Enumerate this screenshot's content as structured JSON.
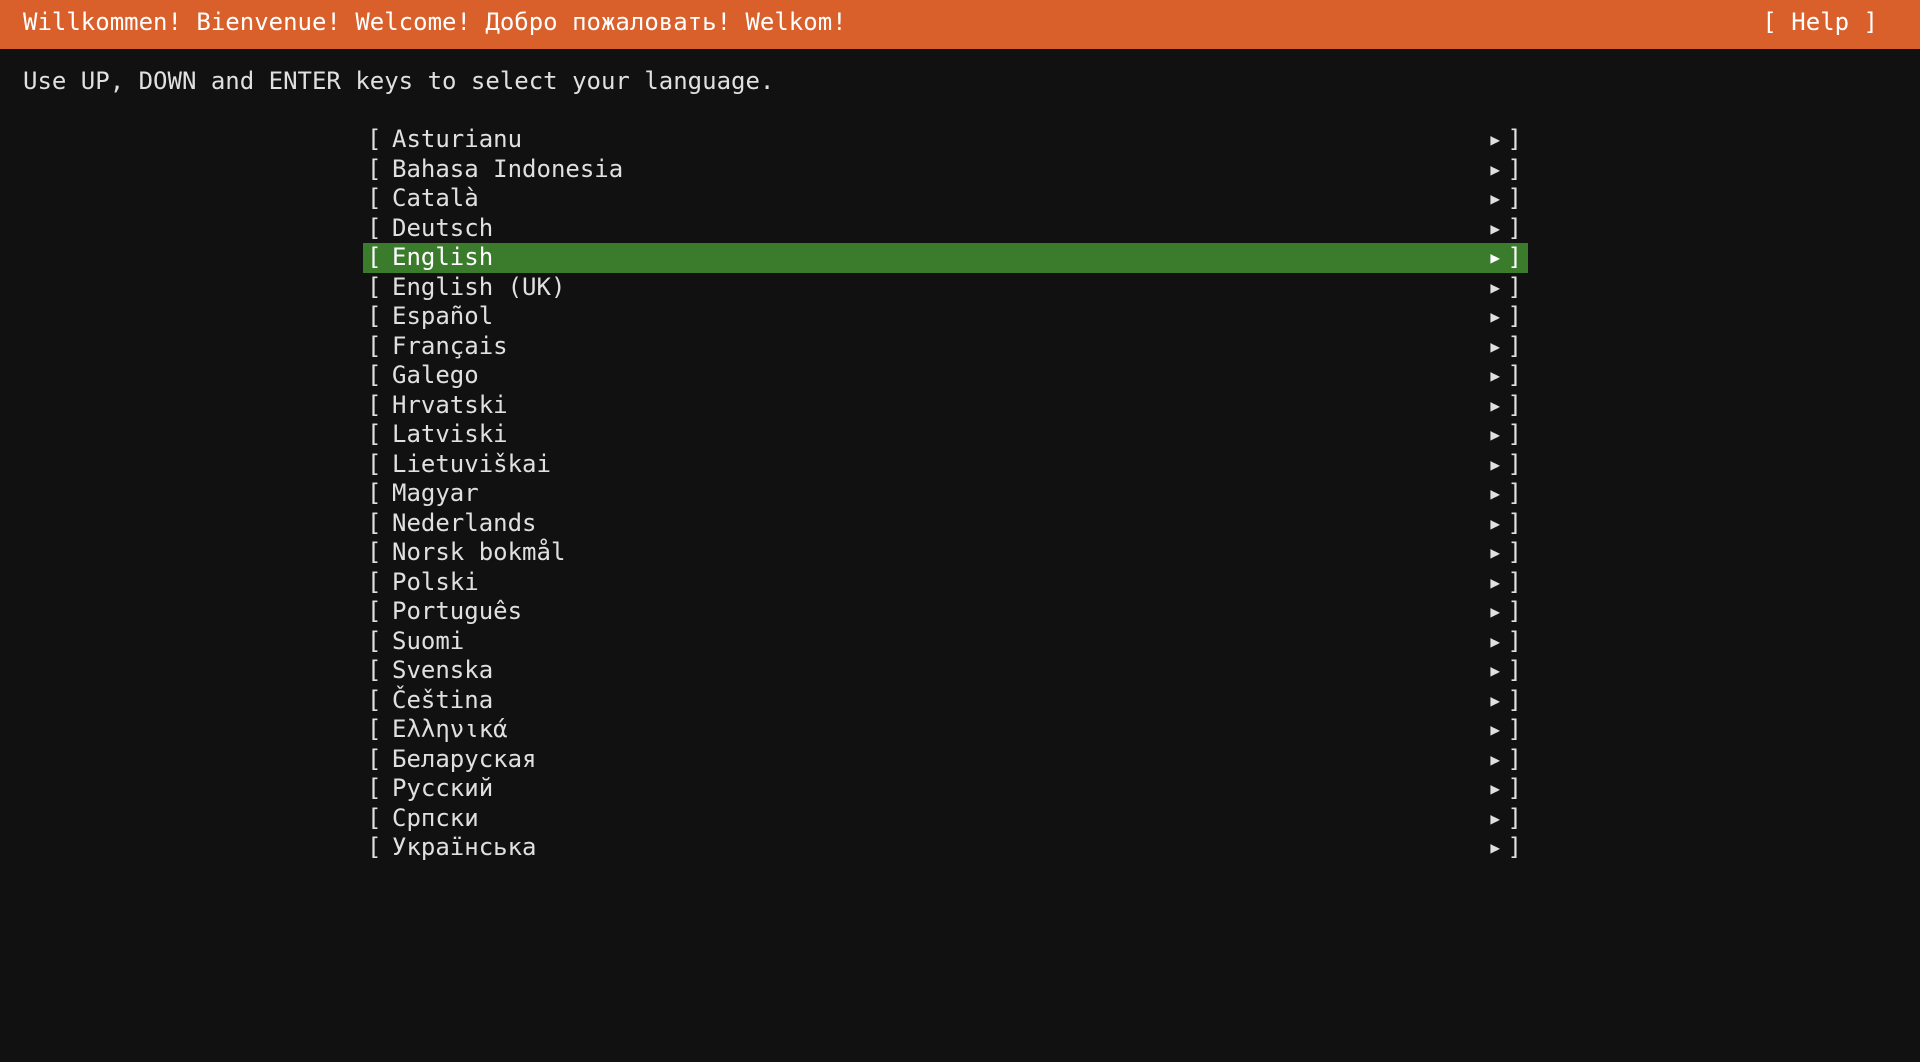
{
  "header": {
    "title": "Willkommen! Bienvenue! Welcome! Добро пожаловать! Welkom!",
    "help_label": "[ Help ]"
  },
  "instructions": "Use UP, DOWN and ENTER keys to select your language.",
  "colors": {
    "header_bg": "#d95f2b",
    "background": "#111111",
    "selected_bg": "#3a7b2c"
  },
  "languages": {
    "selected": "English",
    "items": [
      "Asturianu",
      "Bahasa Indonesia",
      "Català",
      "Deutsch",
      "English",
      "English (UK)",
      "Español",
      "Français",
      "Galego",
      "Hrvatski",
      "Latviski",
      "Lietuviškai",
      "Magyar",
      "Nederlands",
      "Norsk bokmål",
      "Polski",
      "Português",
      "Suomi",
      "Svenska",
      "Čeština",
      "Ελληνικά",
      "Беларуская",
      "Русский",
      "Српски",
      "Українська"
    ]
  }
}
